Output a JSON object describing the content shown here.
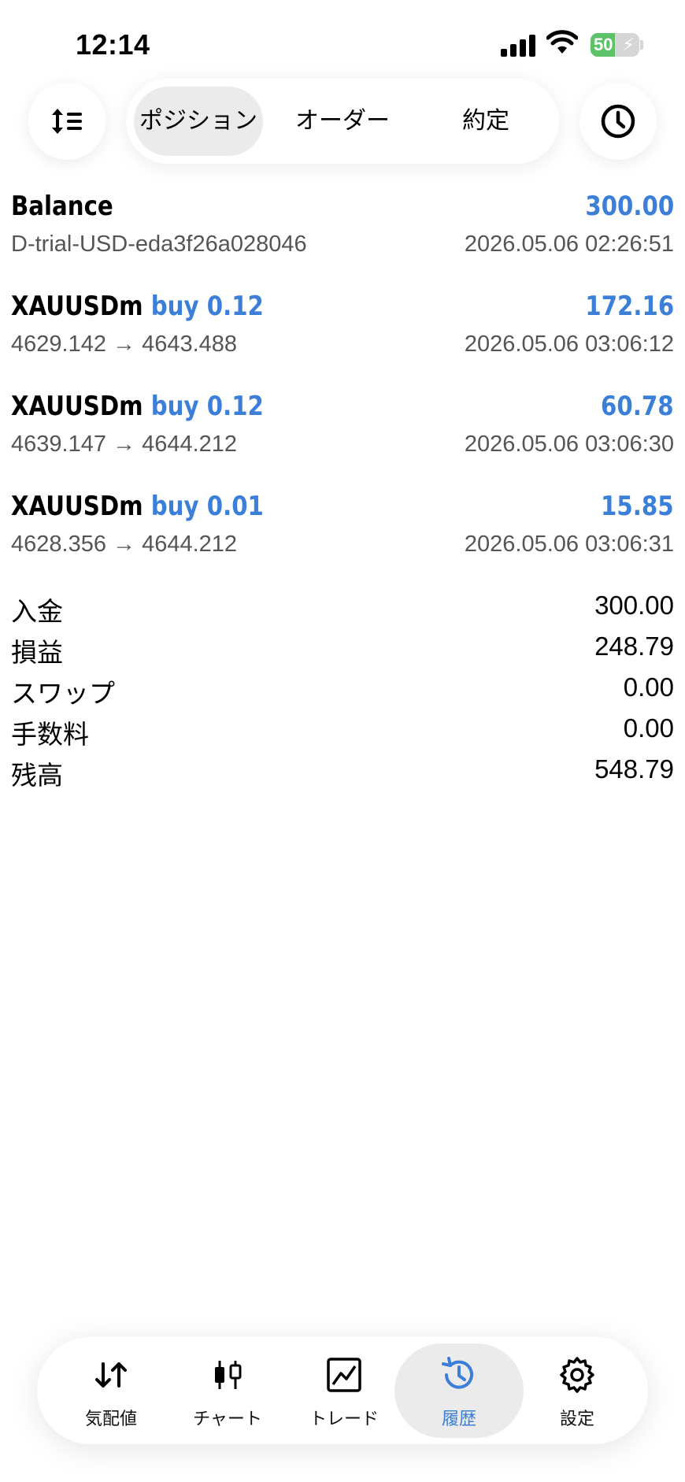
{
  "status": {
    "time": "12:14",
    "battery": "50",
    "battery_level": 0.5
  },
  "toolbar": {
    "tabs": [
      {
        "label": "ポジション",
        "active": true
      },
      {
        "label": "オーダー",
        "active": false
      },
      {
        "label": "約定",
        "active": false
      }
    ]
  },
  "history": [
    {
      "title": "Balance",
      "side": "",
      "value": "300.00",
      "sub": "D-trial-USD-eda3f26a028046",
      "date": "2026.05.06 02:26:51"
    },
    {
      "title": "XAUUSDm",
      "side": "buy 0.12",
      "value": "172.16",
      "sub": "4629.142 → 4643.488",
      "date": "2026.05.06 03:06:12"
    },
    {
      "title": "XAUUSDm",
      "side": "buy 0.12",
      "value": "60.78",
      "sub": "4639.147 → 4644.212",
      "date": "2026.05.06 03:06:30"
    },
    {
      "title": "XAUUSDm",
      "side": "buy 0.01",
      "value": "15.85",
      "sub": "4628.356 → 4644.212",
      "date": "2026.05.06 03:06:31"
    }
  ],
  "summary": [
    {
      "label": "入金",
      "value": "300.00"
    },
    {
      "label": "損益",
      "value": "248.79"
    },
    {
      "label": "スワップ",
      "value": "0.00"
    },
    {
      "label": "手数料",
      "value": "0.00"
    },
    {
      "label": "残高",
      "value": "548.79"
    }
  ],
  "nav": [
    {
      "label": "気配値",
      "icon": "quotes-icon"
    },
    {
      "label": "チャート",
      "icon": "chart-icon"
    },
    {
      "label": "トレード",
      "icon": "trade-icon"
    },
    {
      "label": "履歴",
      "icon": "history-icon",
      "active": true
    },
    {
      "label": "設定",
      "icon": "settings-icon"
    }
  ],
  "colors": {
    "accent": "#3b7fd9",
    "battery": "#5ec26a"
  }
}
